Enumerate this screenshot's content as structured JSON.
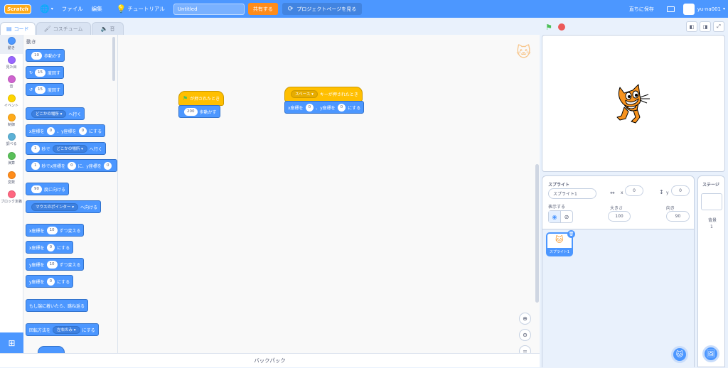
{
  "menubar": {
    "logo": "Scratch",
    "language_icon": "globe-icon",
    "file": "ファイル",
    "edit": "編集",
    "tutorial": "チュートリアル",
    "project_title": "Untitled",
    "share": "共有する",
    "see_project_page": "プロジェクトページを見る",
    "save_now": "直ちに保存",
    "username": "yu-na001"
  },
  "tabs": {
    "code": "コード",
    "costumes": "コスチューム",
    "sounds": "音"
  },
  "categories": [
    {
      "label": "動き",
      "color": "#4c97ff"
    },
    {
      "label": "見た目",
      "color": "#9966ff"
    },
    {
      "label": "音",
      "color": "#cf63cf"
    },
    {
      "label": "イベント",
      "color": "#ffd500"
    },
    {
      "label": "制御",
      "color": "#ffab19"
    },
    {
      "label": "調べる",
      "color": "#5cb1d6"
    },
    {
      "label": "演算",
      "color": "#59c059"
    },
    {
      "label": "変数",
      "color": "#ff8c1a"
    },
    {
      "label": "ブロック定義",
      "color": "#ff6680"
    }
  ],
  "palette": {
    "heading": "動き",
    "move_steps": {
      "value": "10",
      "text": "歩動かす"
    },
    "turn_right": {
      "value": "15",
      "text": "度回す"
    },
    "turn_left": {
      "value": "15",
      "text": "度回す"
    },
    "goto": {
      "dropdown": "どこかの場所",
      "text": "へ行く"
    },
    "goto_xy": {
      "a": "x座標を",
      "x": "0",
      "b": "、y座標を",
      "y": "0",
      "c": "にする"
    },
    "glide_to": {
      "secs": "1",
      "a": "秒で",
      "dropdown": "どこかの場所",
      "b": "へ行く"
    },
    "glide_xy": {
      "secs": "1",
      "a": "秒でx座標を",
      "x": "0",
      "b": "に、y座標を",
      "y": "0"
    },
    "point_dir": {
      "value": "90",
      "text": "度に向ける"
    },
    "point_towards": {
      "dropdown": "マウスのポインター",
      "text": "へ向ける"
    },
    "change_x": {
      "a": "x座標を",
      "value": "10",
      "b": "ずつ変える"
    },
    "set_x": {
      "a": "x座標を",
      "value": "0",
      "b": "にする"
    },
    "change_y": {
      "a": "y座標を",
      "value": "10",
      "b": "ずつ変える"
    },
    "set_y": {
      "a": "y座標を",
      "value": "0",
      "b": "にする"
    },
    "bounce": "もし端に着いたら、跳ね返る",
    "rotation": {
      "a": "回転方法を",
      "dropdown": "左右のみ",
      "b": "にする"
    }
  },
  "scripts": {
    "script1": {
      "hat": "が押されたとき",
      "move": {
        "value": "200",
        "text": "歩動かす"
      }
    },
    "script2": {
      "hat_key": "スペース",
      "hat_text": "キーが押されたとき",
      "goto": {
        "a": "x座標を",
        "x": "0",
        "b": "、y座標を",
        "y": "0",
        "c": "にする"
      }
    }
  },
  "backpack": "バックパック",
  "sprite_info": {
    "sprite_label": "スプライト",
    "sprite_name": "スプライト1",
    "x_label": "x",
    "x_value": "0",
    "y_label": "y",
    "y_value": "0",
    "show_label": "表示する",
    "size_label": "大きさ",
    "size_value": "100",
    "direction_label": "向き",
    "direction_value": "90"
  },
  "sprite_tile": {
    "name": "スプライト1"
  },
  "stage_panel": {
    "title": "ステージ",
    "backdrops_label": "背景",
    "backdrops_count": "1"
  },
  "colors": {
    "accent": "#4c97ff",
    "events": "#ffbf00",
    "share": "#ff8c1a"
  }
}
